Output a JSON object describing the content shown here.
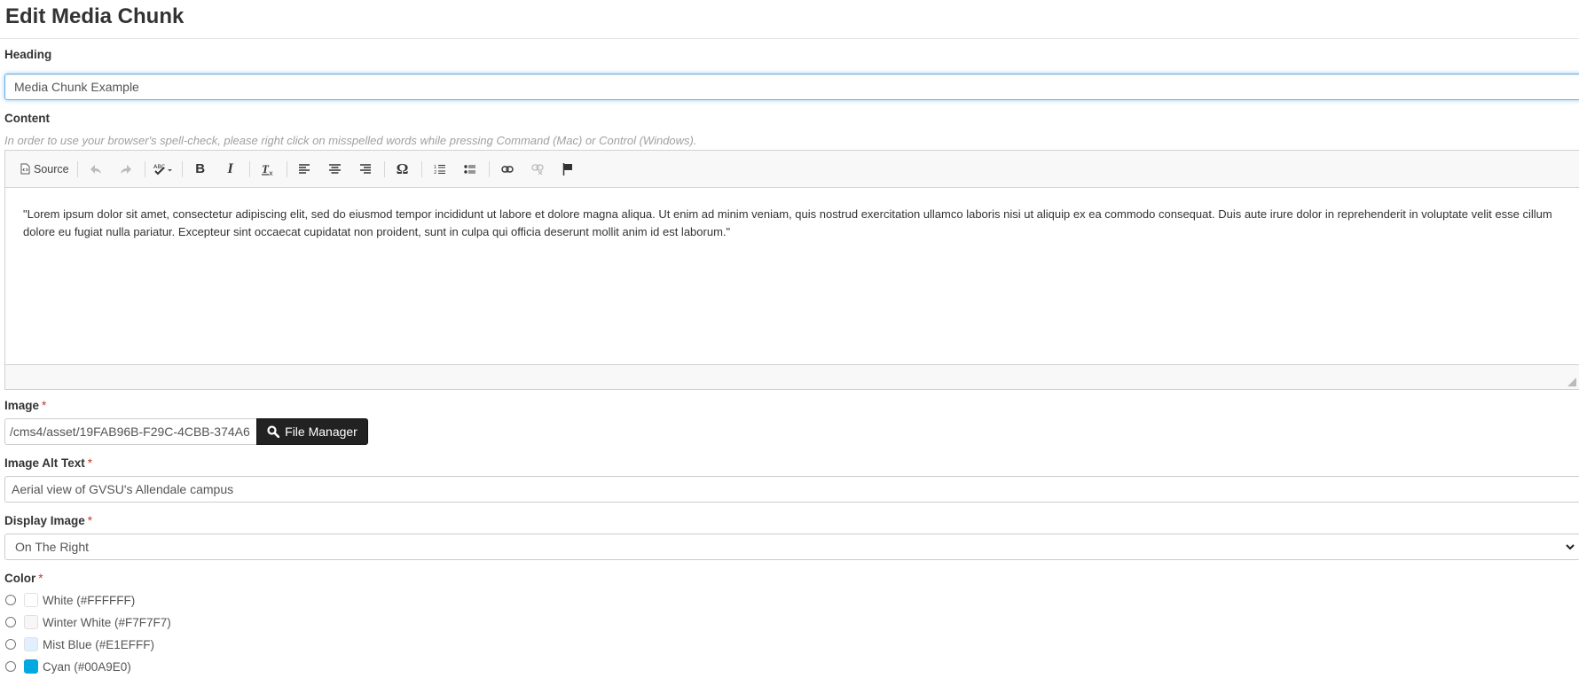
{
  "page": {
    "title": "Edit Media Chunk"
  },
  "heading": {
    "label": "Heading",
    "value": "Media Chunk Example"
  },
  "content": {
    "label": "Content",
    "help": "In order to use your browser's spell-check, please right click on misspelled words while pressing Command (Mac) or Control (Windows).",
    "toolbar": {
      "source_label": "Source",
      "buttons": [
        {
          "name": "source",
          "icon": "source-icon"
        },
        {
          "name": "undo",
          "icon": "undo-icon",
          "disabled": true
        },
        {
          "name": "redo",
          "icon": "redo-icon",
          "disabled": true
        },
        {
          "name": "spellcheck",
          "icon": "spellcheck-icon"
        },
        {
          "name": "bold",
          "icon": "bold-icon",
          "glyph": "B"
        },
        {
          "name": "italic",
          "icon": "italic-icon",
          "glyph": "I"
        },
        {
          "name": "remove-format",
          "icon": "remove-format-icon"
        },
        {
          "name": "align-left",
          "icon": "align-left-icon"
        },
        {
          "name": "align-center",
          "icon": "align-center-icon"
        },
        {
          "name": "align-right",
          "icon": "align-right-icon"
        },
        {
          "name": "special-char",
          "icon": "omega-icon",
          "glyph": "Ω"
        },
        {
          "name": "numbered-list",
          "icon": "numbered-list-icon"
        },
        {
          "name": "bulleted-list",
          "icon": "bulleted-list-icon"
        },
        {
          "name": "link",
          "icon": "link-icon"
        },
        {
          "name": "unlink",
          "icon": "unlink-icon",
          "disabled": true
        },
        {
          "name": "anchor",
          "icon": "flag-icon"
        }
      ]
    },
    "body": "\"Lorem ipsum dolor sit amet, consectetur adipiscing elit, sed do eiusmod tempor incididunt ut labore et dolore magna aliqua. Ut enim ad minim veniam, quis nostrud exercitation ullamco laboris nisi ut aliquip ex ea commodo consequat. Duis aute irure dolor in reprehenderit in voluptate velit esse cillum dolore eu fugiat nulla pariatur. Excepteur sint occaecat cupidatat non proident, sunt in culpa qui officia deserunt mollit anim id est laborum.\""
  },
  "image": {
    "label": "Image",
    "required_mark": "*",
    "value": "/cms4/asset/19FAB96B-F29C-4CBB-374A6",
    "button_label": "File Manager"
  },
  "alt_text": {
    "label": "Image Alt Text",
    "required_mark": "*",
    "value": "Aerial view of GVSU's Allendale campus"
  },
  "display_image": {
    "label": "Display Image",
    "required_mark": "*",
    "selected": "On The Right"
  },
  "color": {
    "label": "Color",
    "required_mark": "*",
    "options": [
      {
        "label": "White (#FFFFFF)",
        "swatch": "#FFFFFF"
      },
      {
        "label": "Winter White (#F7F7F7)",
        "swatch": "#F7F7F7"
      },
      {
        "label": "Mist Blue (#E1EFFF)",
        "swatch": "#E1EFFF"
      },
      {
        "label": "Cyan (#00A9E0)",
        "swatch": "#00A9E0"
      }
    ]
  }
}
